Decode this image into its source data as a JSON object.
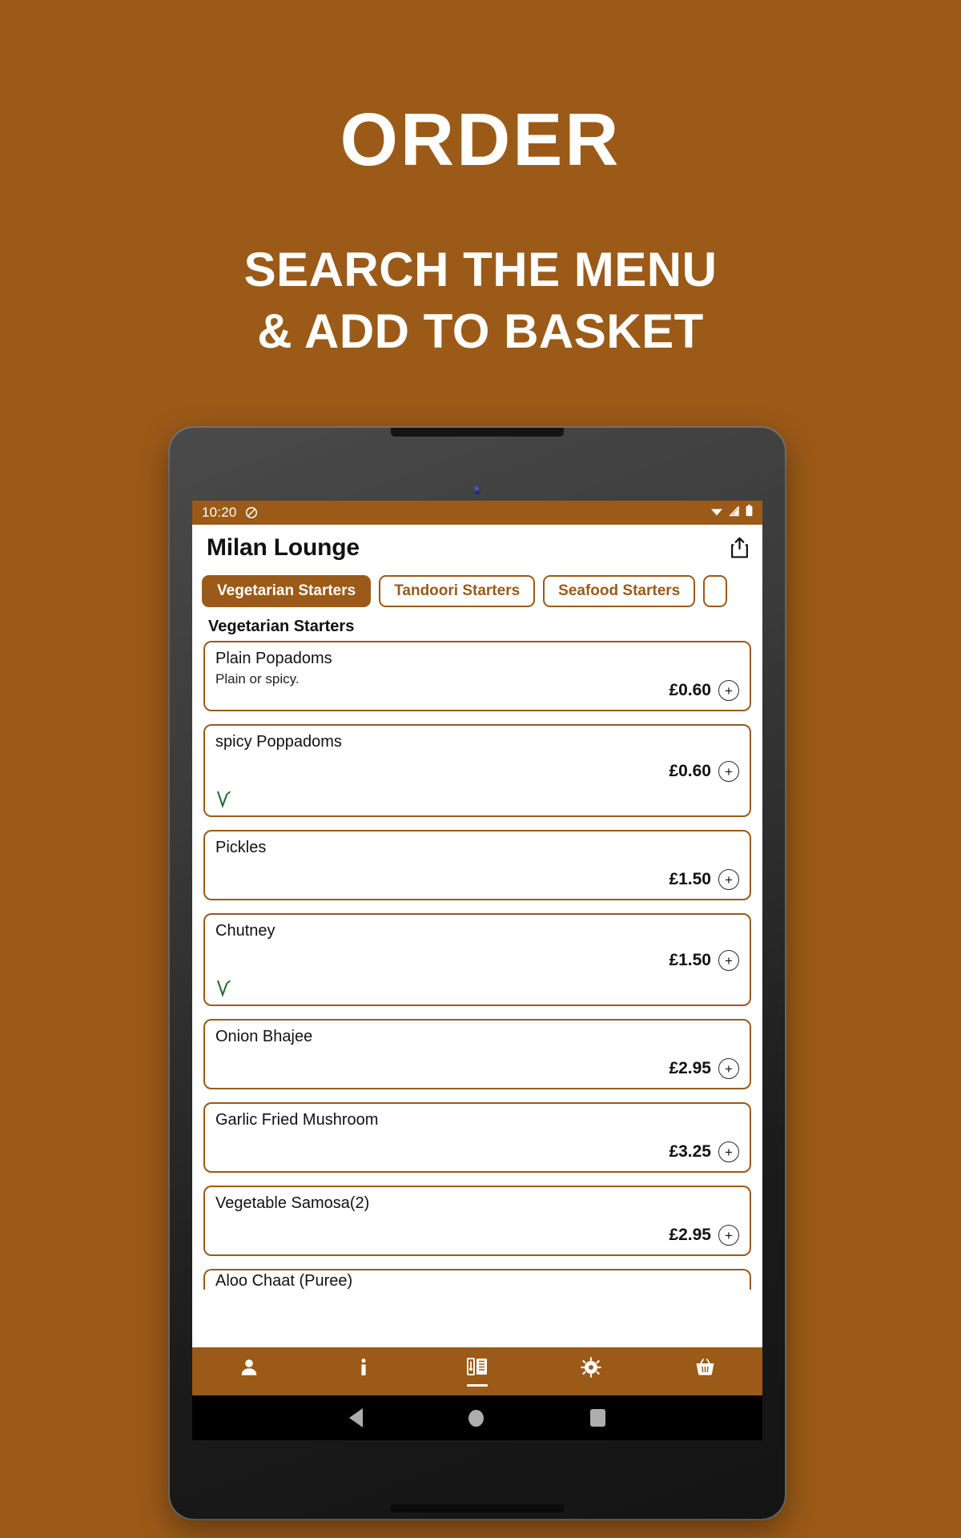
{
  "promo": {
    "title": "ORDER",
    "subtitle_line1": "SEARCH THE MENU",
    "subtitle_line2": "& ADD TO BASKET"
  },
  "colors": {
    "brand_brown": "#9B5A18",
    "veg_green": "#1F6B2E",
    "card_border": "#9B5A18",
    "text_dark": "#111111",
    "white": "#FFFFFF"
  },
  "status_bar": {
    "time": "10:20",
    "mute_icon": "do-not-disturb-icon",
    "wifi_icon": "wifi-icon",
    "signal_icon": "signal-icon",
    "battery_icon": "battery-icon"
  },
  "app_bar": {
    "title": "Milan Lounge",
    "share_icon": "share-icon"
  },
  "tabs": [
    {
      "label": "Vegetarian Starters",
      "active": true
    },
    {
      "label": "Tandoori Starters",
      "active": false
    },
    {
      "label": "Seafood Starters",
      "active": false
    },
    {
      "label": "",
      "active": false
    }
  ],
  "section": {
    "heading": "Vegetarian Starters"
  },
  "menu_items": [
    {
      "name": "Plain Popadoms",
      "description": "Plain or spicy.",
      "price": "£0.60",
      "vegetarian": false,
      "add_label": "+"
    },
    {
      "name": "spicy Poppadoms",
      "description": "",
      "price": "£0.60",
      "vegetarian": true,
      "add_label": "+"
    },
    {
      "name": "Pickles",
      "description": "",
      "price": "£1.50",
      "vegetarian": false,
      "add_label": "+"
    },
    {
      "name": "Chutney",
      "description": "",
      "price": "£1.50",
      "vegetarian": true,
      "add_label": "+"
    },
    {
      "name": "Onion Bhajee",
      "description": "",
      "price": "£2.95",
      "vegetarian": false,
      "add_label": "+"
    },
    {
      "name": "Garlic Fried Mushroom",
      "description": "",
      "price": "£3.25",
      "vegetarian": false,
      "add_label": "+"
    },
    {
      "name": "Vegetable Samosa(2)",
      "description": "",
      "price": "£2.95",
      "vegetarian": false,
      "add_label": "+"
    },
    {
      "name": "Aloo Chaat (Puree)",
      "description": "",
      "price": "",
      "vegetarian": false,
      "add_label": ""
    }
  ],
  "bottom_nav": [
    {
      "icon": "account-icon",
      "active": false
    },
    {
      "icon": "info-icon",
      "active": false
    },
    {
      "icon": "menu-book-icon",
      "active": true
    },
    {
      "icon": "settings-gear-icon",
      "active": false
    },
    {
      "icon": "basket-icon",
      "active": false
    }
  ],
  "android_nav": {
    "back_icon": "back-triangle-icon",
    "home_icon": "home-circle-icon",
    "recents_icon": "recents-square-icon"
  }
}
